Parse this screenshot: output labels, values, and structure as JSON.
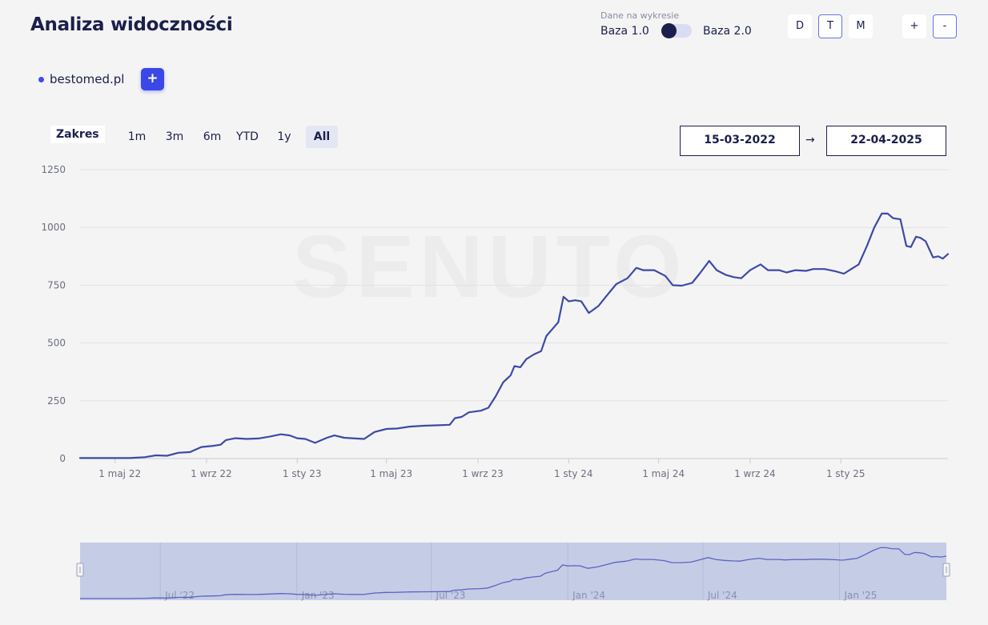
{
  "header": {
    "title": "Analiza widoczności",
    "data_caption": "Dane na wykresie",
    "baza1": "Baza 1.0",
    "baza2": "Baza 2.0",
    "granularity": [
      {
        "label": "D",
        "active": false
      },
      {
        "label": "T",
        "active": true
      },
      {
        "label": "M",
        "active": false
      }
    ],
    "zoom_in": "+",
    "zoom_out": "-"
  },
  "domain": {
    "name": "bestomed.pl",
    "add_label": "+"
  },
  "range": {
    "label": "Zakres",
    "options": [
      {
        "label": "1m",
        "active": false
      },
      {
        "label": "3m",
        "active": false
      },
      {
        "label": "6m",
        "active": false
      },
      {
        "label": "YTD",
        "active": false
      },
      {
        "label": "1y",
        "active": false
      },
      {
        "label": "All",
        "active": true
      }
    ],
    "start": "15-03-2022",
    "end": "22-04-2025",
    "arrow": "→"
  },
  "watermark": "SENUTO",
  "colors": {
    "line": "#3d4aa8",
    "grid": "#e2e2e2",
    "navigator_fill": "#c5cce6",
    "navigator_line": "#5a65c0",
    "accent": "#3a48e8",
    "text": "#1b1f4b",
    "axis_text": "#6b6e80"
  },
  "chart_data": {
    "type": "line",
    "xlabel": "",
    "ylabel": "",
    "ylim": [
      0,
      1250
    ],
    "yticks": [
      0,
      250,
      500,
      750,
      1000,
      1250
    ],
    "xticks": [
      {
        "date": "2022-05-01",
        "label": "1 maj 22"
      },
      {
        "date": "2022-09-01",
        "label": "1 wrz 22"
      },
      {
        "date": "2023-01-01",
        "label": "1 sty 23"
      },
      {
        "date": "2023-05-01",
        "label": "1 maj 23"
      },
      {
        "date": "2023-09-01",
        "label": "1 wrz 23"
      },
      {
        "date": "2024-01-01",
        "label": "1 sty 24"
      },
      {
        "date": "2024-05-01",
        "label": "1 maj 24"
      },
      {
        "date": "2024-09-01",
        "label": "1 wrz 24"
      },
      {
        "date": "2025-01-01",
        "label": "1 sty 25"
      }
    ],
    "navigator_ticks": [
      {
        "date": "2022-07-01",
        "label": "Jul '22"
      },
      {
        "date": "2023-01-01",
        "label": "Jan '23"
      },
      {
        "date": "2023-07-01",
        "label": "Jul '23"
      },
      {
        "date": "2024-01-01",
        "label": "Jan '24"
      },
      {
        "date": "2024-07-01",
        "label": "Jul '24"
      },
      {
        "date": "2025-01-01",
        "label": "Jan '25"
      }
    ],
    "series": [
      {
        "points": [
          [
            "2022-03-15",
            2
          ],
          [
            "2022-05-20",
            2
          ],
          [
            "2022-06-10",
            6
          ],
          [
            "2022-06-25",
            14
          ],
          [
            "2022-07-10",
            12
          ],
          [
            "2022-07-25",
            25
          ],
          [
            "2022-08-10",
            28
          ],
          [
            "2022-08-25",
            50
          ],
          [
            "2022-09-10",
            55
          ],
          [
            "2022-09-20",
            60
          ],
          [
            "2022-09-27",
            80
          ],
          [
            "2022-10-10",
            88
          ],
          [
            "2022-10-25",
            85
          ],
          [
            "2022-11-10",
            87
          ],
          [
            "2022-11-25",
            95
          ],
          [
            "2022-12-10",
            105
          ],
          [
            "2022-12-22",
            100
          ],
          [
            "2023-01-01",
            88
          ],
          [
            "2023-01-12",
            85
          ],
          [
            "2023-01-25",
            68
          ],
          [
            "2023-02-10",
            90
          ],
          [
            "2023-02-20",
            100
          ],
          [
            "2023-03-05",
            90
          ],
          [
            "2023-03-20",
            87
          ],
          [
            "2023-04-01",
            85
          ],
          [
            "2023-04-15",
            115
          ],
          [
            "2023-05-01",
            128
          ],
          [
            "2023-05-15",
            130
          ],
          [
            "2023-06-01",
            138
          ],
          [
            "2023-06-20",
            142
          ],
          [
            "2023-07-10",
            144
          ],
          [
            "2023-07-25",
            146
          ],
          [
            "2023-08-01",
            175
          ],
          [
            "2023-08-10",
            180
          ],
          [
            "2023-08-20",
            200
          ],
          [
            "2023-09-05",
            207
          ],
          [
            "2023-09-15",
            220
          ],
          [
            "2023-09-25",
            270
          ],
          [
            "2023-10-05",
            330
          ],
          [
            "2023-10-15",
            360
          ],
          [
            "2023-10-20",
            400
          ],
          [
            "2023-10-28",
            395
          ],
          [
            "2023-11-05",
            430
          ],
          [
            "2023-11-15",
            450
          ],
          [
            "2023-11-25",
            465
          ],
          [
            "2023-12-02",
            530
          ],
          [
            "2023-12-10",
            560
          ],
          [
            "2023-12-18",
            590
          ],
          [
            "2023-12-25",
            700
          ],
          [
            "2024-01-01",
            680
          ],
          [
            "2024-01-10",
            685
          ],
          [
            "2024-01-18",
            680
          ],
          [
            "2024-01-28",
            630
          ],
          [
            "2024-02-10",
            660
          ],
          [
            "2024-02-20",
            700
          ],
          [
            "2024-03-05",
            755
          ],
          [
            "2024-03-20",
            780
          ],
          [
            "2024-04-01",
            825
          ],
          [
            "2024-04-10",
            815
          ],
          [
            "2024-04-25",
            815
          ],
          [
            "2024-05-10",
            790
          ],
          [
            "2024-05-20",
            750
          ],
          [
            "2024-06-01",
            748
          ],
          [
            "2024-06-15",
            760
          ],
          [
            "2024-06-25",
            800
          ],
          [
            "2024-07-08",
            855
          ],
          [
            "2024-07-18",
            815
          ],
          [
            "2024-07-30",
            795
          ],
          [
            "2024-08-10",
            785
          ],
          [
            "2024-08-20",
            780
          ],
          [
            "2024-09-01",
            815
          ],
          [
            "2024-09-15",
            840
          ],
          [
            "2024-09-25",
            815
          ],
          [
            "2024-10-10",
            815
          ],
          [
            "2024-10-20",
            805
          ],
          [
            "2024-11-01",
            815
          ],
          [
            "2024-11-15",
            812
          ],
          [
            "2024-11-25",
            820
          ],
          [
            "2024-12-10",
            820
          ],
          [
            "2024-12-25",
            810
          ],
          [
            "2025-01-05",
            800
          ],
          [
            "2025-01-15",
            820
          ],
          [
            "2025-01-25",
            840
          ],
          [
            "2025-02-05",
            920
          ],
          [
            "2025-02-15",
            1000
          ],
          [
            "2025-02-25",
            1060
          ],
          [
            "2025-03-05",
            1060
          ],
          [
            "2025-03-12",
            1040
          ],
          [
            "2025-03-22",
            1035
          ],
          [
            "2025-03-30",
            920
          ],
          [
            "2025-04-05",
            915
          ],
          [
            "2025-04-12",
            960
          ],
          [
            "2025-04-18",
            955
          ],
          [
            "2025-04-25",
            940
          ],
          [
            "2025-05-05",
            870
          ],
          [
            "2025-05-12",
            875
          ],
          [
            "2025-05-18",
            865
          ],
          [
            "2025-05-25",
            885
          ]
        ]
      }
    ]
  }
}
